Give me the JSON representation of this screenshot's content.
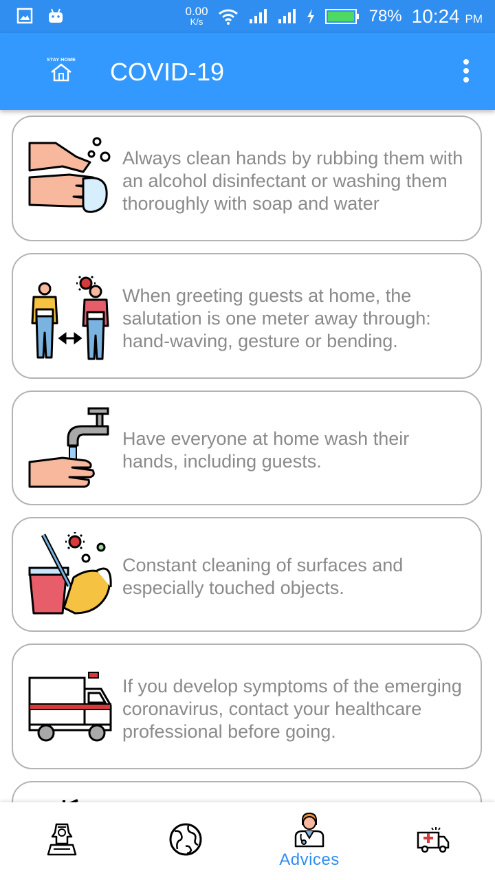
{
  "status_bar": {
    "speed_value": "0.00",
    "speed_unit": "K/s",
    "battery_percent": "78%",
    "time": "10:24",
    "ampm": "PM"
  },
  "app_bar": {
    "logo_text": "STAY HOME",
    "title": "COVID-19"
  },
  "advices": [
    {
      "icon": "hand-washing-icon",
      "text": "Always clean hands by rubbing them with an alcohol disinfectant or washing them thoroughly with soap and water"
    },
    {
      "icon": "social-distance-icon",
      "text": "When greeting guests at home, the salutation is one meter away through: hand-waving, gesture or bending."
    },
    {
      "icon": "faucet-hand-icon",
      "text": "Have everyone at home wash their hands, including guests."
    },
    {
      "icon": "cleaning-bucket-icon",
      "text": "Constant cleaning of surfaces and especially touched objects."
    },
    {
      "icon": "ambulance-icon",
      "text": "If you develop symptoms of the emerging coronavirus, contact your healthcare professional before going."
    }
  ],
  "bottom_nav": {
    "items": [
      {
        "icon": "sphinx-icon",
        "label": ""
      },
      {
        "icon": "globe-icon",
        "label": ""
      },
      {
        "icon": "doctor-icon",
        "label": "Advices"
      },
      {
        "icon": "ambulance-icon",
        "label": ""
      }
    ],
    "active_index": 2
  },
  "colors": {
    "primary": "#3399ff",
    "status_bar": "#2f8ef0",
    "card_border": "#b3b3b3",
    "advice_text": "#8a8a8a"
  }
}
